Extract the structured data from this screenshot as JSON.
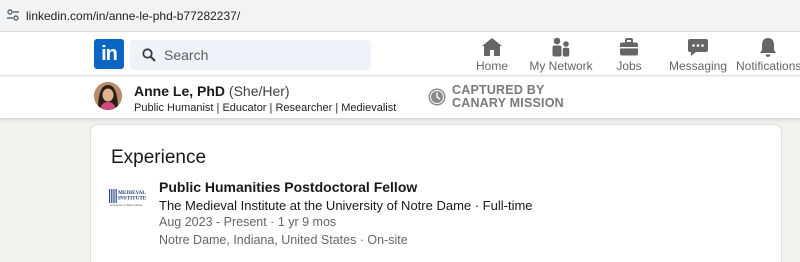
{
  "browser": {
    "url": "linkedin.com/in/anne-le-phd-b77282237/"
  },
  "topnav": {
    "logo_text": "in",
    "search_placeholder": "Search",
    "items": [
      {
        "label": "Home",
        "icon": "home-icon"
      },
      {
        "label": "My Network",
        "icon": "network-icon"
      },
      {
        "label": "Jobs",
        "icon": "briefcase-icon"
      },
      {
        "label": "Messaging",
        "icon": "message-icon"
      },
      {
        "label": "Notifications",
        "icon": "bell-icon"
      }
    ]
  },
  "profile": {
    "name": "Anne Le, PhD",
    "pronouns": "(She/Her)",
    "headline": "Public Humanist | Educator | Researcher | Medievalist",
    "badge_line1": "CAPTURED BY",
    "badge_line2": "CANARY MISSION"
  },
  "experience": {
    "section_title": "Experience",
    "entry": {
      "title": "Public Humanities Postdoctoral Fellow",
      "company": "The Medieval Institute at the University of Notre Dame · Full-time",
      "dates": "Aug 2023 - Present · 1 yr 9 mos",
      "location": "Notre Dame, Indiana, United States · On-site",
      "logo_line1": "MEDIEVAL",
      "logo_line2": "INSTITUTE",
      "logo_line3": "University of Notre Dame"
    }
  },
  "colors": {
    "brand": "#0a66c2",
    "page_bg": "#f4f2ee",
    "search_bg": "#edf3f8"
  }
}
